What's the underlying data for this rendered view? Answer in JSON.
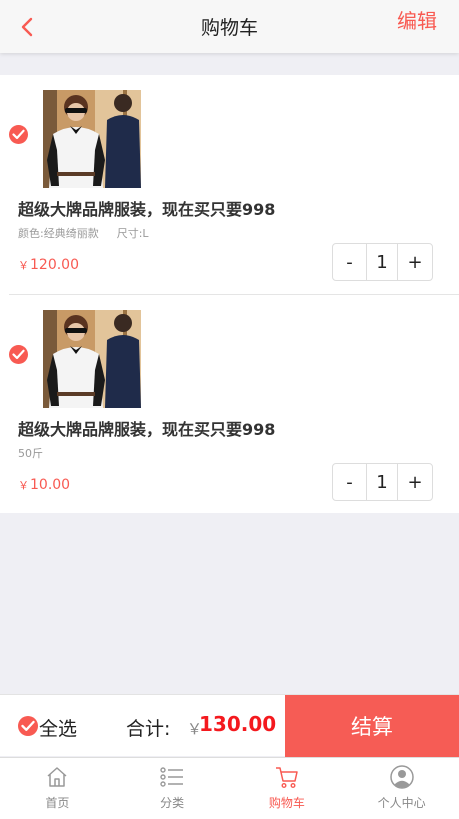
{
  "header": {
    "title": "购物车",
    "edit_label": "编辑"
  },
  "cart": {
    "items": [
      {
        "title": "超级大牌品牌服装，现在买只要998",
        "specs": [
          "颜色:经典绮丽款",
          "尺寸:L"
        ],
        "currency": "￥",
        "price": "120.00",
        "quantity": "1",
        "selected": true
      },
      {
        "title": "超级大牌品牌服装，现在买只要998",
        "specs": [
          "50斤"
        ],
        "currency": "￥",
        "price": "10.00",
        "quantity": "1",
        "selected": true
      }
    ],
    "qty_minus": "-",
    "qty_plus": "+"
  },
  "checkout": {
    "select_all_label": "全选",
    "total_label": "合计:",
    "currency": "￥",
    "total_value": "130.00",
    "pay_label": "结算"
  },
  "tabbar": {
    "tabs": [
      {
        "label": "首页",
        "icon": "home-icon"
      },
      {
        "label": "分类",
        "icon": "list-icon"
      },
      {
        "label": "购物车",
        "icon": "cart-icon",
        "active": true
      },
      {
        "label": "个人中心",
        "icon": "user-icon"
      }
    ]
  },
  "colors": {
    "accent": "#f85a52",
    "total": "#f4191e",
    "background": "#efeff4"
  }
}
